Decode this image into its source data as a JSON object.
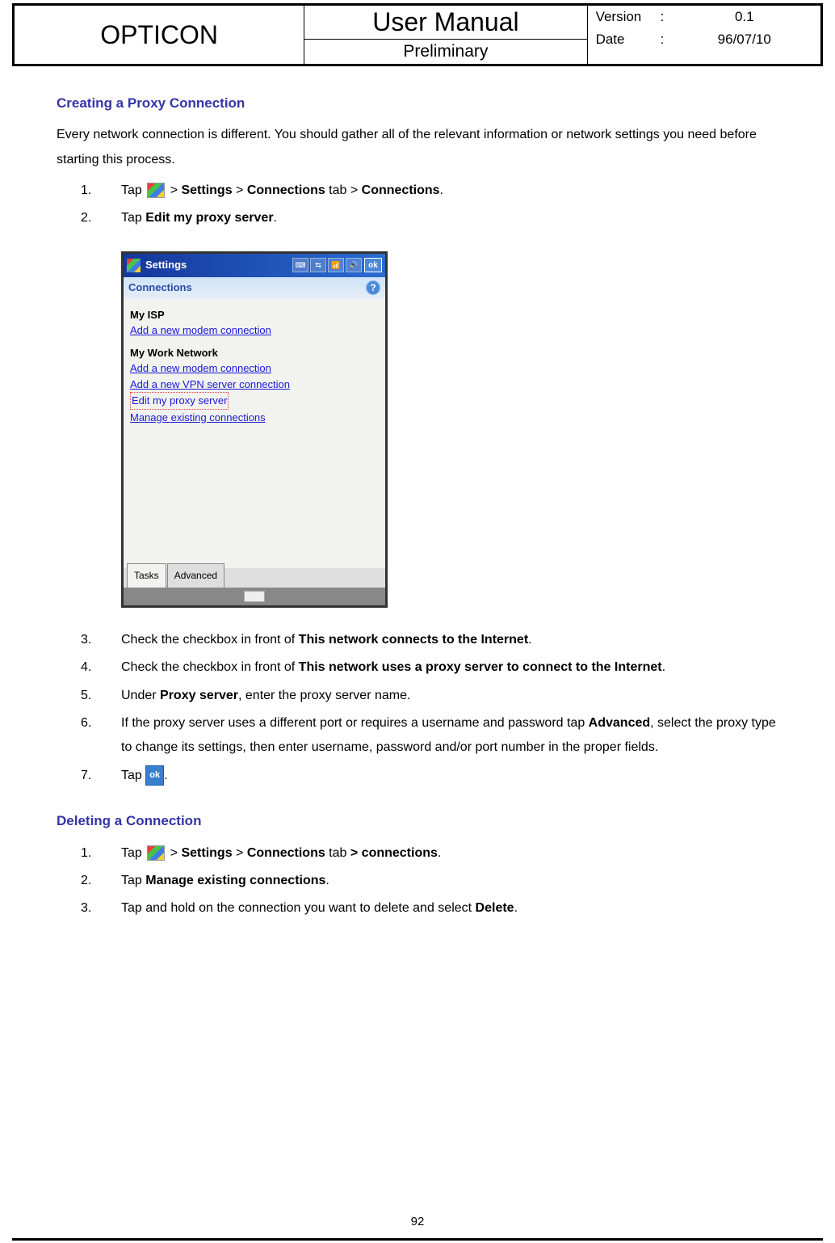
{
  "header": {
    "company": "OPTICON",
    "title": "User Manual",
    "subtitle": "Preliminary",
    "version_label": "Version",
    "version_value": "0.1",
    "date_label": "Date",
    "date_value": "96/07/10",
    "colon": ":"
  },
  "section1": {
    "heading": "Creating a Proxy Connection",
    "intro": "Every network connection is different. You should gather all of the relevant information or network settings you need before starting this process.",
    "steps": {
      "s1_pre": "Tap ",
      "s1_mid": " > ",
      "s1_b1": "Settings",
      "s1_b2": "Connections",
      "s1_af2": " tab > ",
      "s1_b3": "Connections",
      "s1_end": ".",
      "s2_pre": "Tap ",
      "s2_b": "Edit my proxy server",
      "s2_end": ".",
      "s3_pre": "Check the checkbox in front of ",
      "s3_b": "This network connects to the Internet",
      "s3_end": ".",
      "s4_pre": "Check the checkbox in front of ",
      "s4_b": "This network uses a proxy server to connect to the Internet",
      "s4_end": ".",
      "s5_pre": "Under ",
      "s5_b": "Proxy server",
      "s5_end": ", enter the proxy server name.",
      "s6_pre": "If the proxy server uses a different port or requires a username and password tap ",
      "s6_b": "Advanced",
      "s6_end": ", select the proxy type to change its settings, then enter username, password and/or port number in the proper fields.",
      "s7_pre": "Tap ",
      "s7_ok": "ok",
      "s7_end": "."
    }
  },
  "screenshot": {
    "title": "Settings",
    "subtitle": "Connections",
    "help": "?",
    "ok": "ok",
    "group1": "My ISP",
    "g1_link1": "Add a new modem connection",
    "group2": "My Work Network",
    "g2_link1": "Add a new modem connection",
    "g2_link2": "Add a new VPN server connection",
    "g2_link3": "Edit my proxy server",
    "g2_link4": "Manage existing connections",
    "tab1": "Tasks",
    "tab2": "Advanced"
  },
  "section2": {
    "heading": "Deleting a Connection",
    "steps": {
      "s1_pre": "Tap ",
      "s1_mid": " > ",
      "s1_b1": "Settings",
      "s1_b2": "Connections",
      "s1_af2": " tab ",
      "s1_b3": "> connections",
      "s1_end": ".",
      "s2_pre": "Tap ",
      "s2_b": "Manage existing connections",
      "s2_end": ".",
      "s3_pre": "Tap and hold on the connection you want to delete and select ",
      "s3_b": "Delete",
      "s3_end": "."
    }
  },
  "nums": {
    "n1": "1.",
    "n2": "2.",
    "n3": "3.",
    "n4": "4.",
    "n5": "5.",
    "n6": "6.",
    "n7": "7."
  },
  "page_number": "92"
}
